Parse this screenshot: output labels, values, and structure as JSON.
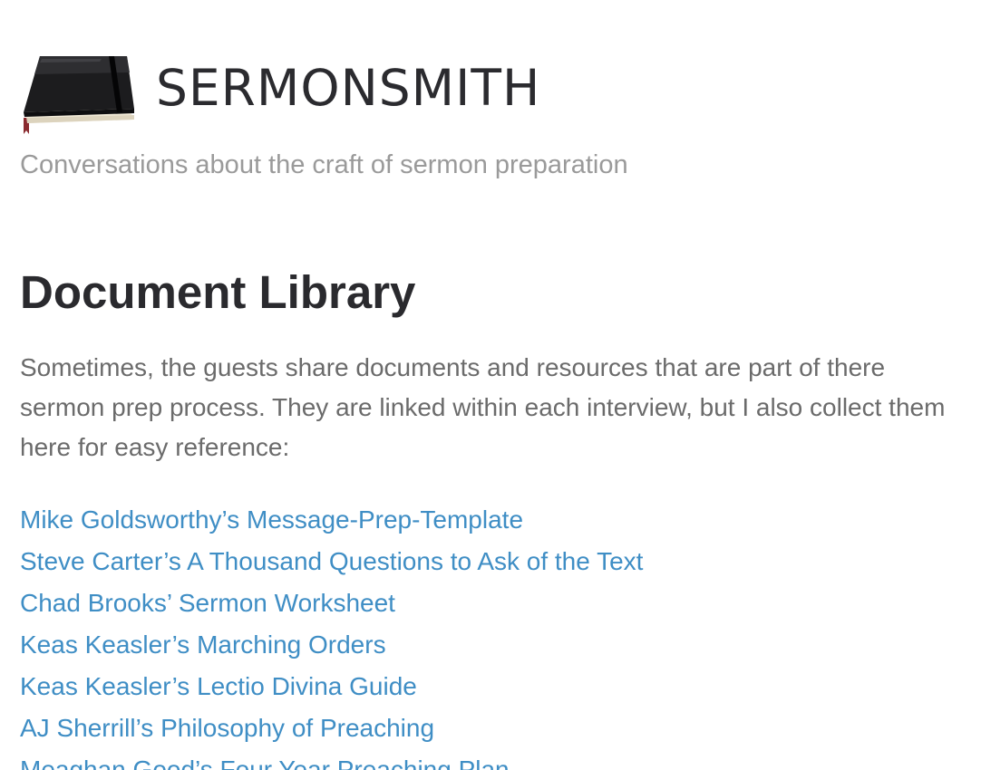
{
  "site": {
    "title": "SERMONSMITH",
    "tagline": "Conversations about the craft of sermon preparation",
    "logo_icon": "notebook-icon"
  },
  "main": {
    "heading": "Document Library",
    "intro": "Sometimes, the guests share documents and resources that are part of there sermon prep process. They are linked within each interview, but I also collect them here for easy reference:",
    "documents": [
      "Mike Goldsworthy’s Message-Prep-Template",
      "Steve Carter’s A Thousand Questions to Ask of the Text",
      "Chad Brooks’ Sermon Worksheet",
      "Keas Keasler’s Marching Orders",
      "Keas Keasler’s Lectio Divina Guide",
      "AJ Sherrill’s Philosophy of Preaching",
      "Meaghan Good’s Four Year Preaching Plan"
    ]
  },
  "colors": {
    "link": "#3f8ec5",
    "title": "#2b2b2f",
    "tagline": "#9a9a9a",
    "body_text": "#6b6b6b"
  }
}
